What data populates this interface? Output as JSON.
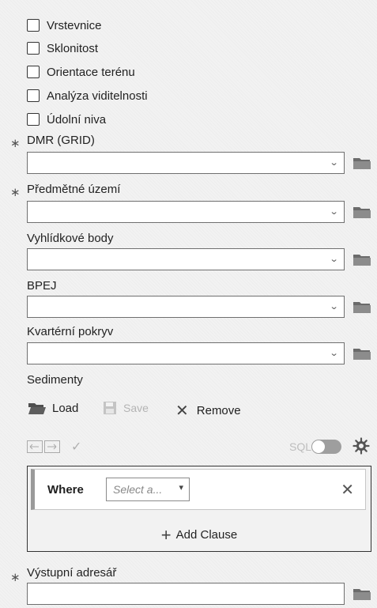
{
  "checkboxes": [
    {
      "label": "Vrstevnice",
      "checked": false
    },
    {
      "label": "Sklonitost",
      "checked": false
    },
    {
      "label": "Orientace terénu",
      "checked": false
    },
    {
      "label": "Analýza viditelnosti",
      "checked": false
    },
    {
      "label": "Údolní niva",
      "checked": false
    }
  ],
  "required_marker": "∗",
  "fields": {
    "dmr": {
      "label": "DMR (GRID)",
      "value": ""
    },
    "predmetne": {
      "label": "Předmětné území",
      "value": ""
    },
    "vyhlidkove": {
      "label": "Vyhlídkové body",
      "value": ""
    },
    "bpej": {
      "label": "BPEJ",
      "value": ""
    },
    "kvarterni": {
      "label": "Kvartérní pokryv",
      "value": ""
    },
    "vystupni": {
      "label": "Výstupní adresář",
      "value": ""
    }
  },
  "sediment": {
    "label": "Sedimenty",
    "load": "Load",
    "save": "Save",
    "remove": "Remove",
    "sql": "SQL",
    "sql_enabled": false
  },
  "query": {
    "where": "Where",
    "select_placeholder": "Select a...",
    "add_clause": "Add Clause"
  },
  "icons": {
    "chevron": "chevron-down-icon",
    "folder": "folder-icon",
    "settings": "gear-icon"
  }
}
